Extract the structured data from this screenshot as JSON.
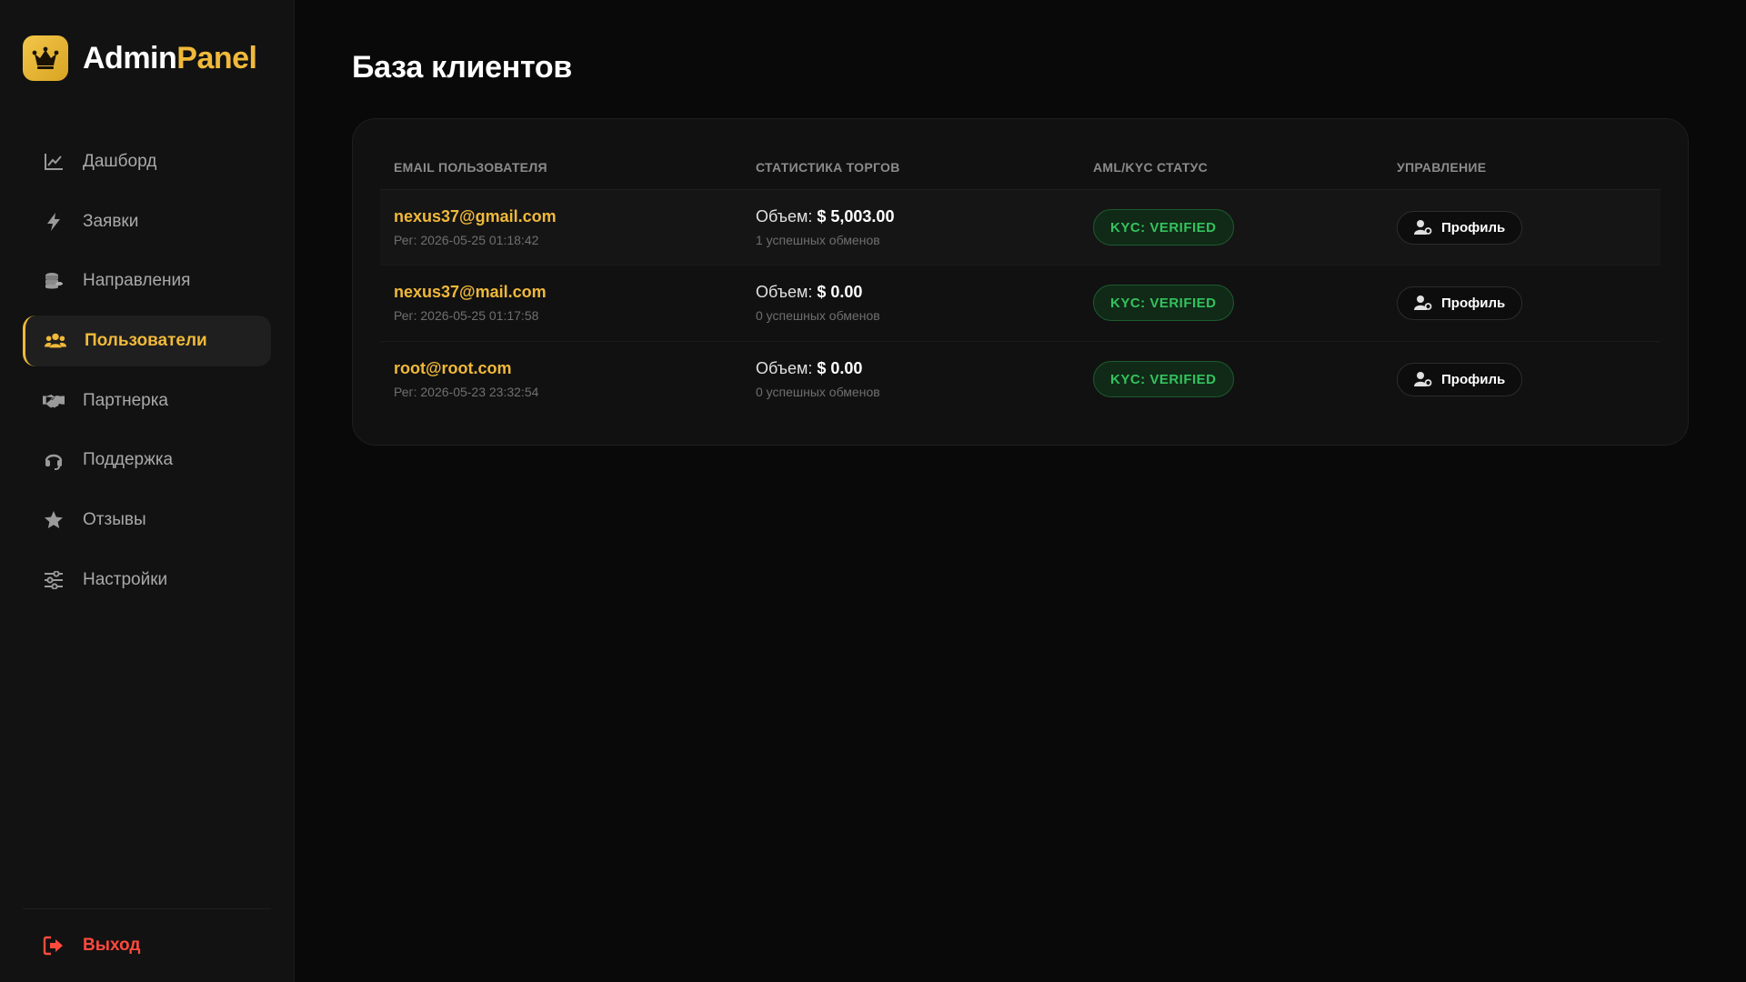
{
  "brand": {
    "name_part1": "Admin",
    "name_part2": "Panel",
    "accent": "#f0b93a",
    "icon": "crown-icon"
  },
  "sidebar": {
    "items": [
      {
        "label": "Дашборд",
        "icon": "chart-line-icon",
        "active": false
      },
      {
        "label": "Заявки",
        "icon": "bolt-icon",
        "active": false
      },
      {
        "label": "Направления",
        "icon": "coins-icon",
        "active": false
      },
      {
        "label": "Пользователи",
        "icon": "users-icon",
        "active": true
      },
      {
        "label": "Партнерка",
        "icon": "handshake-icon",
        "active": false
      },
      {
        "label": "Поддержка",
        "icon": "headset-icon",
        "active": false
      },
      {
        "label": "Отзывы",
        "icon": "star-icon",
        "active": false
      },
      {
        "label": "Настройки",
        "icon": "sliders-icon",
        "active": false
      }
    ],
    "logout": {
      "label": "Выход",
      "icon": "logout-icon",
      "color": "#ff4a3d"
    }
  },
  "main": {
    "title": "База клиентов",
    "table": {
      "headers": [
        "Email пользователя",
        "Статистика торгов",
        "AML/KYC Статус",
        "Управление"
      ],
      "rows": [
        {
          "email": "nexus37@gmail.com",
          "reg": "Рег: 2026-05-25 01:18:42",
          "volume_label": "Объем:",
          "volume": "$ 5,003.00",
          "success": "1 успешных обменов",
          "kyc": "KYC: VERIFIED",
          "action": "Профиль"
        },
        {
          "email": "nexus37@mail.com",
          "reg": "Рег: 2026-05-25 01:17:58",
          "volume_label": "Объем:",
          "volume": "$ 0.00",
          "success": "0 успешных обменов",
          "kyc": "KYC: VERIFIED",
          "action": "Профиль"
        },
        {
          "email": "root@root.com",
          "reg": "Рег: 2026-05-23 23:32:54",
          "volume_label": "Объем:",
          "volume": "$ 0.00",
          "success": "0 успешных обменов",
          "kyc": "KYC: VERIFIED",
          "action": "Профиль"
        }
      ]
    }
  }
}
